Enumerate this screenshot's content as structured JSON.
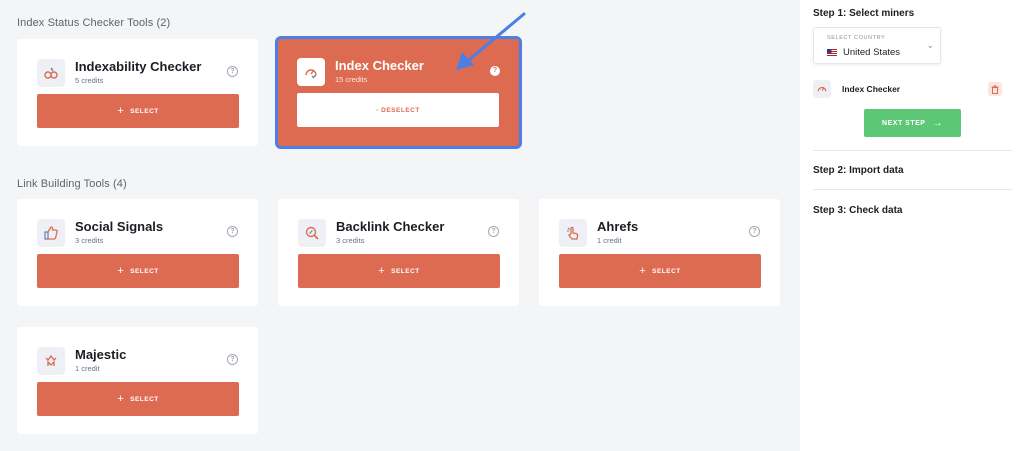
{
  "sections": {
    "index_status": {
      "title": "Index Status Checker Tools (2)"
    },
    "link_building": {
      "title": "Link Building Tools (4)"
    }
  },
  "tools": {
    "indexability": {
      "name": "Indexability Checker",
      "credits": "5 credits",
      "button": "SELECT",
      "icon": "chain-link-icon"
    },
    "index_checker": {
      "name": "Index Checker",
      "credits": "15 credits",
      "button": "- DESELECT",
      "selected": true,
      "icon": "gauge-check-icon"
    },
    "social_signals": {
      "name": "Social Signals",
      "credits": "3 credits",
      "button": "SELECT",
      "icon": "thumbs-up-icon"
    },
    "backlink_checker": {
      "name": "Backlink Checker",
      "credits": "3 credits",
      "button": "SELECT",
      "icon": "magnifier-link-icon"
    },
    "ahrefs": {
      "name": "Ahrefs",
      "credits": "1 credit",
      "button": "SELECT",
      "icon": "hand-pointer-icon"
    },
    "majestic": {
      "name": "Majestic",
      "credits": "1 credit",
      "button": "SELECT",
      "icon": "crown-m-icon"
    }
  },
  "help_glyph": "?",
  "plus_glyph": "+",
  "sidebar": {
    "step1": {
      "title": "Step 1: Select miners"
    },
    "country": {
      "label": "SELECT COUNTRY",
      "value": "United States",
      "chevron": "⌄"
    },
    "selected_tool": {
      "name": "Index Checker"
    },
    "next_button": {
      "label": "NEXT STEP",
      "arrow": "→"
    },
    "step2": {
      "title": "Step 2: Import data"
    },
    "step3": {
      "title": "Step 3: Check data"
    }
  },
  "colors": {
    "accent": "#dd6b52",
    "selected_border": "#4c7fe6",
    "next_step": "#5cc876",
    "background": "#f4f5f7"
  }
}
